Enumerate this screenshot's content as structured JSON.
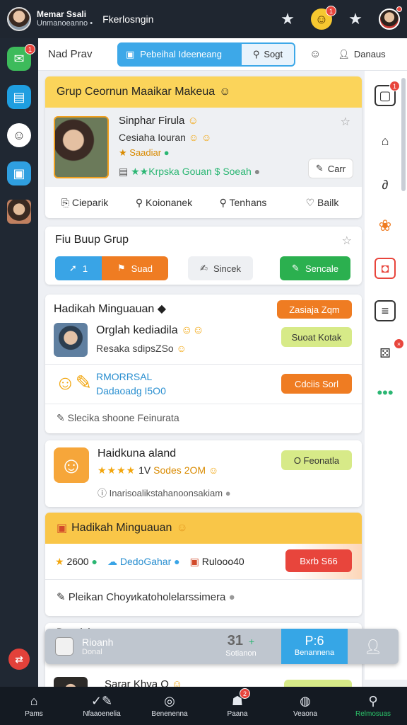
{
  "topbar": {
    "user_line1": "Memar Ssali",
    "user_line2": "Unmanoeanno •",
    "title": "Fkerlosngin",
    "icons": [
      "star-icon",
      "emoji-icon",
      "star-outline-icon",
      "avatar-icon"
    ],
    "emoji_badge": "1"
  },
  "header": {
    "title": "Nad Prav",
    "tab_active": "Pebeihal Ideeneang",
    "tab_other": "Sogt",
    "user_label": "Danaus"
  },
  "leftrail": {
    "badge": "1"
  },
  "card1": {
    "header": "Grup Ceornun Maaikar Makeua",
    "name": "Sinphar Firula",
    "subtitle": "Cesiaha Iouran",
    "status": "Saadiar",
    "rating_text": "Krpska Gouan",
    "rating_extra": "Soeah",
    "button": "Carr",
    "actions": [
      "Cieparik",
      "Koionanek",
      "Tenhans",
      "Bailk"
    ]
  },
  "card2": {
    "title": "Fiu Buup Grup",
    "btn_a_num": "1",
    "btn_a_label": "Suad",
    "btn_b": "Sincek",
    "btn_c": "Sencale"
  },
  "card3": {
    "title": "Hadikah Minguauan",
    "tag": "Zasiaja Zqm",
    "item1_name": "Orglah kediadila",
    "item1_sub": "Resaka sdipsZSo",
    "item1_btn": "Suoat Kotak",
    "item2_name": "RMORRSAL",
    "item2_sub": "Dadaoadg I5O0",
    "item2_btn": "Cdciis Sorl",
    "footer": "Slecika shoone Feinurata"
  },
  "card4": {
    "title": "Haidkuna aland",
    "sub_num": "1V",
    "sub_text": "Sodes 2OM",
    "btn": "O Feonatla",
    "footer": "Inarisoalikstahanoonsakiam"
  },
  "card5": {
    "header": "Hadikah Minguauan",
    "stat1": "2600",
    "stat2": "DedoGahar",
    "stat3": "Rulooo40",
    "btn": "Bxrb S66",
    "footer": "Pleikan Choyиkatoholelarssimera"
  },
  "card6": {
    "title": "Sarar Khya O",
    "partial_title": "Dnnalnh"
  },
  "stats": {
    "label1": "Rioanh",
    "label2": "Donal",
    "value": "31",
    "value_label": "Sotianon",
    "active_value": "P:6",
    "active_label": "Benannena"
  },
  "bottomnav": {
    "items": [
      "Pams",
      "Nfaaoenelia",
      "Benenenna",
      "Paana",
      "Veaona",
      "Relmosuas"
    ],
    "badge": "2"
  },
  "colors": {
    "accent_blue": "#3da8e8",
    "header_yellow": "#fbd45a",
    "green": "#2bb673",
    "orange": "#ef7c22",
    "red": "#e8453c"
  }
}
